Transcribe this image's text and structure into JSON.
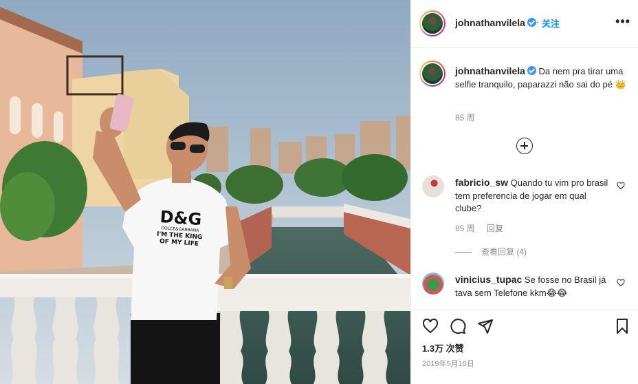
{
  "post": {
    "author": "johnathanvilela",
    "follow_separator": "·",
    "follow_label": "关注",
    "more_label": "•••",
    "caption": "Da nem pra tirar uma selfie tranquilo, paparazzi não sai do pé 👑",
    "caption_time": "85 周",
    "photo_shirt_brand": "D&G",
    "photo_shirt_line1": "DOLCE&GABBANA",
    "photo_shirt_line2": "I'M THE KING",
    "photo_shirt_line3": "OF MY LIFE"
  },
  "comments": [
    {
      "username": "fabricio_sw",
      "text": "Quando tu vim pro brasil tem preferencia de jogar em qual clube?",
      "time": "85 周",
      "reply_label": "回复",
      "view_replies": "查看回复 (4)"
    },
    {
      "username": "vinicius_tupac",
      "text": "Se fosse no Brasil já tava sem Telefone kkm😂😂"
    }
  ],
  "footer": {
    "likes": "1.3万 次赞",
    "date": "2019年5月10日"
  },
  "icons": {
    "like": "heart-icon",
    "comment": "comment-icon",
    "share": "share-icon",
    "save": "bookmark-icon",
    "verified": "verified-badge-icon",
    "load_more": "plus-circle-icon"
  },
  "colors": {
    "accent": "#0095f6",
    "verified": "#3897f0",
    "muted": "#8e8e8e",
    "text": "#262626"
  }
}
